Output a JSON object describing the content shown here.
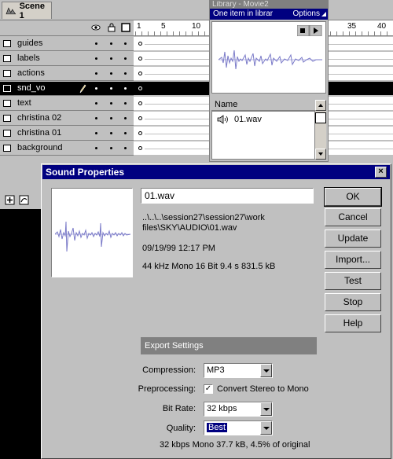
{
  "scene": {
    "tab_label": "Scene 1"
  },
  "timeline": {
    "header_icons": [
      "eye-icon",
      "lock-icon",
      "outline-square-icon"
    ],
    "ruler_numbers": [
      "1",
      "5",
      "10",
      "35",
      "40"
    ],
    "layers": [
      {
        "name": "guides",
        "selected": false
      },
      {
        "name": "labels",
        "selected": false
      },
      {
        "name": "actions",
        "selected": false
      },
      {
        "name": "snd_vo",
        "selected": true
      },
      {
        "name": "text",
        "selected": false
      },
      {
        "name": "christina 02",
        "selected": false
      },
      {
        "name": "christina 01",
        "selected": false
      },
      {
        "name": "background",
        "selected": false
      }
    ],
    "bottom_tools": [
      "add-layer-icon",
      "add-guide-layer-icon"
    ]
  },
  "library": {
    "window_title": "Library - Movie2",
    "status": "One item in librar",
    "options_label": "Options",
    "list_header": "Name",
    "items": [
      {
        "name": "01.wav",
        "icon": "speaker-icon"
      }
    ]
  },
  "dialog": {
    "title": "Sound Properties",
    "close_label": "×",
    "file_name": "01.wav",
    "path": "..\\..\\..\\session27\\session27\\work files\\SKY\\AUDIO\\01.wav",
    "path_line1": "..\\..\\..\\session27\\session27\\work",
    "path_line2": "files\\SKY\\AUDIO\\01.wav",
    "date": "09/19/99 12:17 PM",
    "format": "44 kHz Mono 16 Bit 9.4 s 831.5 kB",
    "buttons": {
      "ok": "OK",
      "cancel": "Cancel",
      "update": "Update",
      "import": "Import...",
      "test": "Test",
      "stop": "Stop",
      "help": "Help"
    },
    "export": {
      "header": "Export Settings",
      "compression_label": "Compression:",
      "compression_value": "MP3",
      "preprocessing_label": "Preprocessing:",
      "preprocessing_option": "Convert Stereo to Mono",
      "preprocessing_checked": true,
      "bitrate_label": "Bit Rate:",
      "bitrate_value": "32 kbps",
      "quality_label": "Quality:",
      "quality_value": "Best",
      "summary": "32 kbps Mono 37.7 kB, 4.5% of original"
    }
  },
  "colors": {
    "title_bar": "#000080",
    "face": "#c0c0c0",
    "waveform": "#7a7ac8"
  }
}
